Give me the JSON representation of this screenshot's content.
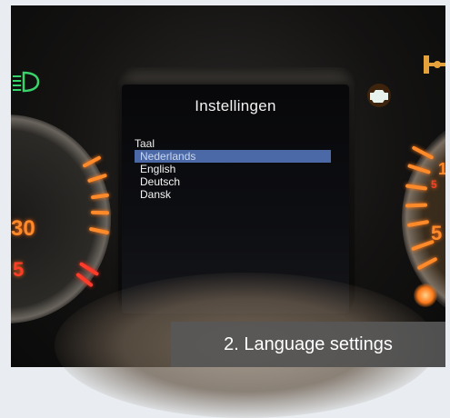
{
  "display": {
    "title": "Instellingen",
    "menu_header": "Taal",
    "items": [
      {
        "label": "Nederlands",
        "selected": true
      },
      {
        "label": "English",
        "selected": false
      },
      {
        "label": "Deutsch",
        "selected": false
      },
      {
        "label": "Dansk",
        "selected": false
      }
    ],
    "selection_color": "#4b69a7"
  },
  "gauges": {
    "left_number": "30",
    "left_number_lower": "5",
    "right_numbers": [
      "1",
      "5",
      "5"
    ]
  },
  "caption": {
    "text": "2. Language settings"
  },
  "icons": [
    "headlight-icon",
    "engine-warning-icon",
    "differential-lock-icon"
  ],
  "colors": {
    "gauge_orange": "#ff8a2a",
    "gauge_red": "#ff3b2a",
    "indicator_green": "#39d36b"
  }
}
